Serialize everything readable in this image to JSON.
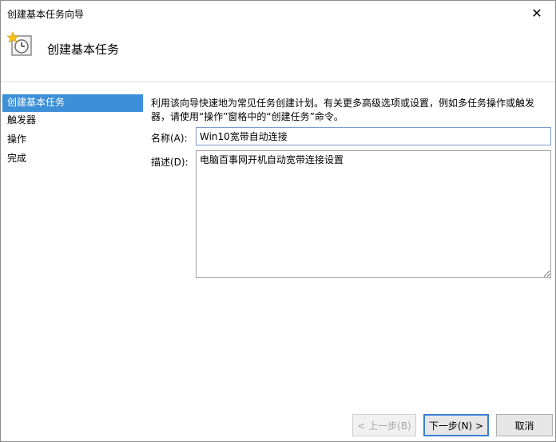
{
  "window": {
    "title": "创建基本任务向导",
    "close_icon": "close-icon"
  },
  "header": {
    "title": "创建基本任务",
    "icon": "clock-wizard-icon"
  },
  "sidebar": {
    "items": [
      {
        "label": "创建基本任务",
        "active": true
      },
      {
        "label": "触发器",
        "active": false
      },
      {
        "label": "操作",
        "active": false
      },
      {
        "label": "完成",
        "active": false
      }
    ]
  },
  "main": {
    "description": "利用该向导快速地为常见任务创建计划。有关更多高级选项或设置，例如多任务操作或触发器，请使用“操作”窗格中的“创建任务”命令。",
    "name_label": "名称(A):",
    "name_value": "Win10宽带自动连接",
    "desc_label": "描述(D):",
    "desc_value": "电脑百事网开机自动宽带连接设置"
  },
  "buttons": {
    "back": "< 上一步(B)",
    "next": "下一步(N) >",
    "cancel": "取消"
  },
  "colors": {
    "accent": "#3d8fd8",
    "focus_border": "#3c7fd2"
  }
}
